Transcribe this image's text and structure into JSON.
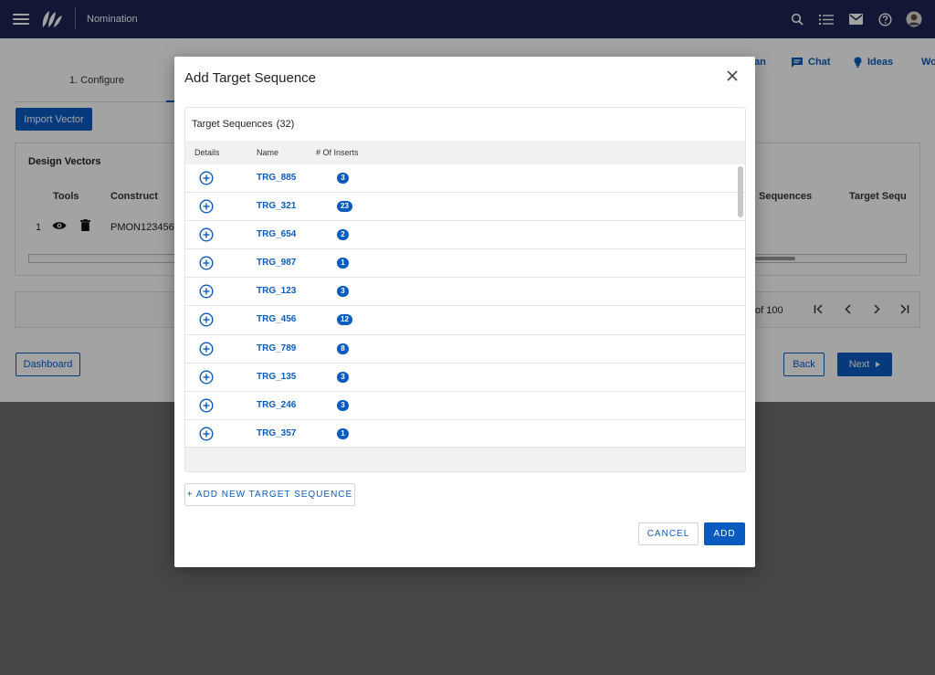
{
  "header": {
    "app_name": "Nomination",
    "icons": [
      "menu-icon",
      "logo",
      "search-icon",
      "list-icon",
      "mail-icon",
      "help-icon",
      "avatar"
    ]
  },
  "background": {
    "step_label": "1. Configure",
    "import_button": "Import Vector",
    "design_vectors_title": "Design Vectors",
    "columns": [
      "Tools",
      "Construct",
      "Sequences",
      "Target Sequ"
    ],
    "row": {
      "index": "1",
      "construct": "PMON123456"
    },
    "pagination_text": "of 100",
    "pagination_icons": [
      "first-page-icon",
      "prev-page-icon",
      "next-page-icon",
      "last-page-icon"
    ],
    "dashboard_button": "Dashboard",
    "back_button": "Back",
    "next_button": "Next",
    "top_links": [
      {
        "label": "an"
      },
      {
        "label": "Chat",
        "icon": "chat-icon"
      },
      {
        "label": "Ideas",
        "icon": "lightbulb-icon"
      },
      {
        "label": "Wo"
      }
    ]
  },
  "modal": {
    "title": "Add Target Sequence",
    "panel_title": "Target Sequences",
    "count": "(32)",
    "columns": {
      "details": "Details",
      "name": "Name",
      "inserts": "# Of Inserts"
    },
    "rows": [
      {
        "name": "TRG_885",
        "inserts": "3"
      },
      {
        "name": "TRG_321",
        "inserts": "23"
      },
      {
        "name": "TRG_654",
        "inserts": "2"
      },
      {
        "name": "TRG_987",
        "inserts": "1"
      },
      {
        "name": "TRG_123",
        "inserts": "3"
      },
      {
        "name": "TRG_456",
        "inserts": "12"
      },
      {
        "name": "TRG_789",
        "inserts": "8"
      },
      {
        "name": "TRG_135",
        "inserts": "3"
      },
      {
        "name": "TRG_246",
        "inserts": "3"
      },
      {
        "name": "TRG_357",
        "inserts": "1"
      }
    ],
    "add_new_label": "+ ADD NEW TARGET SEQUENCE",
    "cancel_label": "CANCEL",
    "add_label": "ADD"
  },
  "colors": {
    "header": "#1b2454",
    "primary": "#0a5bbf"
  }
}
